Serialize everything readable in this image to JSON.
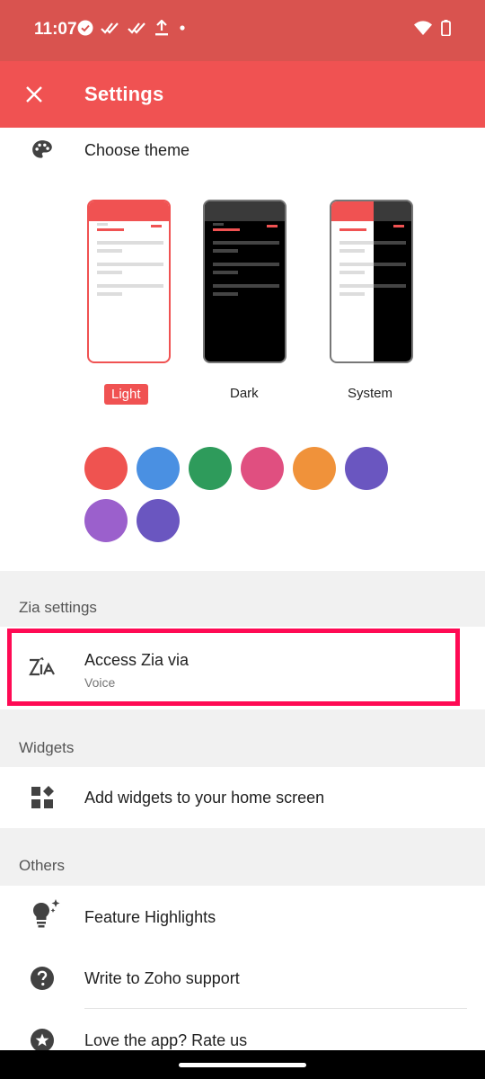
{
  "status_bar": {
    "time": "11:07"
  },
  "app_bar": {
    "title": "Settings"
  },
  "theme": {
    "row_title": "Choose theme",
    "options": [
      {
        "label": "Light",
        "selected": true
      },
      {
        "label": "Dark",
        "selected": false
      },
      {
        "label": "System",
        "selected": false
      }
    ],
    "accent_colors": [
      "#ef5350",
      "#4a90e2",
      "#2e9b5b",
      "#e04f80",
      "#f0923a",
      "#6a56c0",
      "#9b60cc",
      "#6a56c0"
    ]
  },
  "zia": {
    "section_header": "Zia settings",
    "access_title": "Access Zia via",
    "access_value": "Voice"
  },
  "widgets": {
    "section_header": "Widgets",
    "add_widgets": "Add widgets to your home screen"
  },
  "others": {
    "section_header": "Others",
    "feature_highlights": "Feature Highlights",
    "write_support": "Write to Zoho support",
    "rate_us": "Love the app? Rate us"
  },
  "colors": {
    "primary": "#f05252",
    "status_bar": "#d9534f",
    "highlight": "#ff0a54"
  }
}
